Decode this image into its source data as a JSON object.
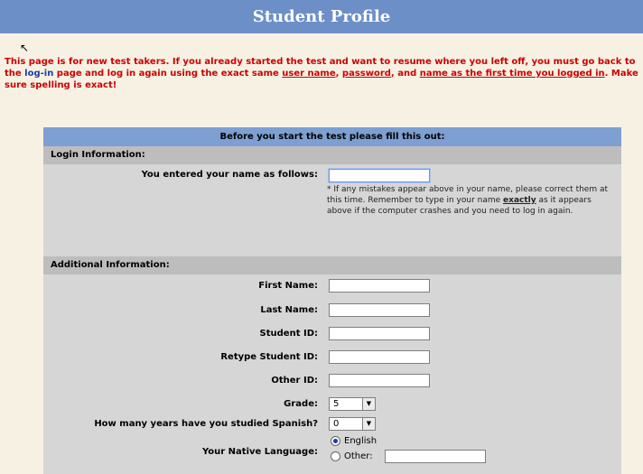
{
  "header": {
    "title": "Student Profile"
  },
  "notice": {
    "part1": "This page is for new test takers. If you already started the test and want to resume where you left off, you must go back to the ",
    "login_link": "log-in",
    "part2": " page and log in again using the exact same ",
    "user_name": "user name",
    "sep1": ", ",
    "password": "password",
    "part3": ", and ",
    "name_first_time": "name as the first time you logged in",
    "part4": ". Make sure spelling is exact!"
  },
  "panel": {
    "heading": "Before you start the test please fill this out:",
    "login_section": "Login Information:",
    "name_label": "You entered your name as follows:",
    "name_value": "",
    "note_part1": "* If any mistakes appear above in your name, please correct them at this time. Remember to type in your name ",
    "note_exactly": "exactly",
    "note_part2": " as it appears above if the computer crashes and you need to log in again.",
    "additional_section": "Additional Information:",
    "fields": [
      {
        "label": "First Name:",
        "value": ""
      },
      {
        "label": "Last Name:",
        "value": ""
      },
      {
        "label": "Student ID:",
        "value": ""
      },
      {
        "label": "Retype Student ID:",
        "value": ""
      },
      {
        "label": "Other ID:",
        "value": ""
      }
    ],
    "grade_label": "Grade:",
    "grade_value": "5",
    "years_label": "How many years have you studied Spanish?",
    "years_value": "0",
    "language_label": "Your Native Language:",
    "language_option_english": "English",
    "language_option_other": "Other:",
    "language_other_value": ""
  }
}
